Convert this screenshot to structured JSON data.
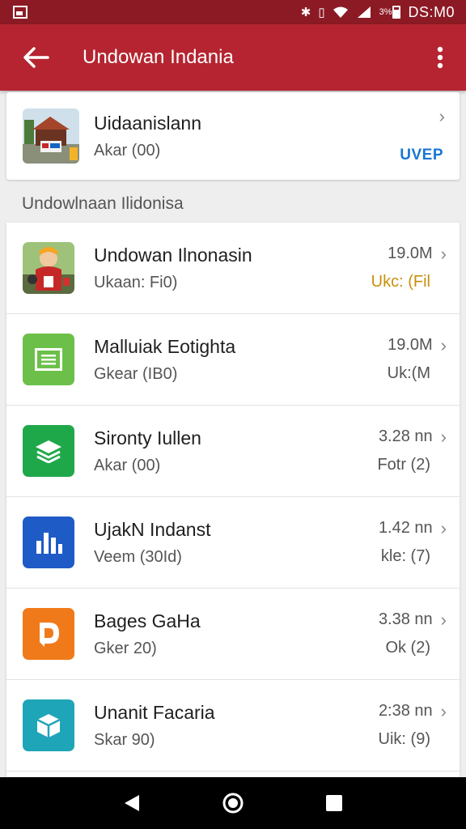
{
  "status_bar": {
    "battery": "3%",
    "time": "DS:M0"
  },
  "app_bar": {
    "title": "Undowan Indania",
    "back_icon": "back-arrow-icon",
    "menu_icon": "more-vert-icon"
  },
  "featured": {
    "title": "Uidaanislann",
    "subtitle": "Akar (00)",
    "badge": "UVEP",
    "badge_color": "#1976d2"
  },
  "section_title": "Undowlnaan Ilidonisa",
  "apps": [
    {
      "title": "Undowan Ilnonasin",
      "subtitle": "Ukaan: Fi0)",
      "size": "19.0M",
      "status": "Ukc: (Fil",
      "icon": "mascot-image"
    },
    {
      "title": "Malluiak Eotighta",
      "subtitle": "Gkear (IB0)",
      "size": "19.0M",
      "status": "Uk:(M",
      "icon": "document-icon"
    },
    {
      "title": "Sironty Iullen",
      "subtitle": "Akar (00)",
      "size": "3.28 nn",
      "status": "Fotr (2)",
      "icon": "layers-icon"
    },
    {
      "title": "UjakN Indanst",
      "subtitle": "Veem (30Id)",
      "size": "1.42 nn",
      "status": "kle: (7)",
      "icon": "chart-icon"
    },
    {
      "title": "Bages GaHa",
      "subtitle": "Gker 20)",
      "size": "3.38 nn",
      "status": "Ok (2)",
      "icon": "pages-icon"
    },
    {
      "title": "Unanit Facaria",
      "subtitle": "Skar 90)",
      "size": "2:38 nn",
      "status": "Uik: (9)",
      "icon": "box-icon"
    }
  ],
  "colors": {
    "status_bar": "#8c1a24",
    "app_bar": "#b52430",
    "accent_status": "#c8900a"
  }
}
